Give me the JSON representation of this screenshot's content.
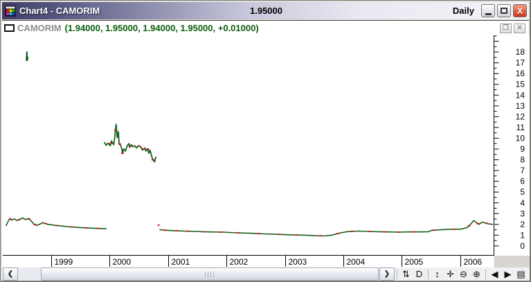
{
  "window": {
    "title": "Chart4 - CAMORIM",
    "price_display": "1.95000",
    "periodicity": "Daily",
    "close_glyph": "X"
  },
  "chart_window": {
    "symbol": "CAMORIM",
    "quote": "(1.94000, 1.95000, 1.94000, 1.95000, +0.01000)"
  },
  "chart_data": {
    "type": "line",
    "title": "CAMORIM daily price history",
    "xlim": [
      1998.23,
      2006.57
    ],
    "ylim": [
      -0.84,
      19.55
    ],
    "x_tick_years": [
      1999,
      2000,
      2001,
      2002,
      2003,
      2004,
      2005,
      2006
    ],
    "x_tick_labels": [
      "1999",
      "2000",
      "2001",
      "2002",
      "2003",
      "2004",
      "2005",
      "2006"
    ],
    "y_tick_labels": [
      0,
      1,
      2,
      3,
      4,
      5,
      6,
      7,
      8,
      9,
      10,
      11,
      12,
      13,
      14,
      15,
      16,
      17,
      18
    ],
    "y_minor_step": 0.5,
    "grid": false,
    "line_color": "#14601c",
    "down_color": "#c82020",
    "axis_color": "#000000",
    "segments": [
      {
        "name": "isolated-spike-1998",
        "width": 2,
        "points": [
          [
            1998.575,
            17.25
          ],
          [
            1998.585,
            18.0
          ],
          [
            1998.585,
            17.2
          ],
          [
            1998.6,
            17.5
          ]
        ]
      },
      {
        "name": "low-band-1998-1999",
        "width": 1.6,
        "points": [
          [
            1998.23,
            1.9
          ],
          [
            1998.25,
            2.15
          ],
          [
            1998.29,
            2.55
          ],
          [
            1998.32,
            2.4
          ],
          [
            1998.37,
            2.5
          ],
          [
            1998.42,
            2.35
          ],
          [
            1998.47,
            2.5
          ],
          [
            1998.51,
            2.6
          ],
          [
            1998.56,
            2.45
          ],
          [
            1998.61,
            2.55
          ],
          [
            1998.66,
            2.3
          ],
          [
            1998.7,
            2.05
          ],
          [
            1998.75,
            1.9
          ],
          [
            1998.8,
            2.0
          ],
          [
            1998.85,
            2.15
          ],
          [
            1998.89,
            2.1
          ],
          [
            1998.94,
            2.0
          ],
          [
            1999.01,
            1.95
          ],
          [
            1999.08,
            1.9
          ],
          [
            1999.18,
            1.85
          ],
          [
            1999.27,
            1.8
          ],
          [
            1999.37,
            1.75
          ],
          [
            1999.46,
            1.72
          ],
          [
            1999.58,
            1.68
          ],
          [
            1999.7,
            1.65
          ],
          [
            1999.82,
            1.62
          ],
          [
            1999.94,
            1.6
          ]
        ]
      },
      {
        "name": "high-band-2000",
        "width": 1.8,
        "points": [
          [
            1999.91,
            9.6
          ],
          [
            1999.94,
            9.35
          ],
          [
            1999.97,
            9.55
          ],
          [
            2000.01,
            9.3
          ],
          [
            2000.03,
            9.75
          ],
          [
            2000.07,
            9.4
          ],
          [
            2000.09,
            10.2
          ],
          [
            2000.11,
            11.3
          ],
          [
            2000.13,
            10.05
          ],
          [
            2000.15,
            10.6
          ],
          [
            2000.16,
            9.55
          ],
          [
            2000.19,
            9.3
          ],
          [
            2000.21,
            9.0
          ],
          [
            2000.22,
            8.6
          ],
          [
            2000.24,
            9.0
          ],
          [
            2000.27,
            8.8
          ],
          [
            2000.3,
            9.3
          ],
          [
            2000.33,
            9.5
          ],
          [
            2000.34,
            9.15
          ],
          [
            2000.37,
            9.4
          ],
          [
            2000.4,
            9.2
          ],
          [
            2000.43,
            9.3
          ],
          [
            2000.46,
            9.1
          ],
          [
            2000.49,
            9.3
          ],
          [
            2000.53,
            9.2
          ],
          [
            2000.56,
            8.9
          ],
          [
            2000.6,
            9.1
          ],
          [
            2000.62,
            8.8
          ],
          [
            2000.65,
            9.0
          ],
          [
            2000.67,
            8.6
          ],
          [
            2000.69,
            8.9
          ],
          [
            2000.72,
            8.3
          ],
          [
            2000.74,
            8.0
          ],
          [
            2000.77,
            7.8
          ],
          [
            2000.79,
            8.25
          ]
        ]
      },
      {
        "name": "isolated-dot-2000",
        "width": 2,
        "color": "#c82020",
        "points": [
          [
            2000.83,
            1.9
          ],
          [
            2000.845,
            1.95
          ]
        ]
      },
      {
        "name": "low-band-2000-2006",
        "width": 1.6,
        "points": [
          [
            2000.86,
            1.5
          ],
          [
            2000.98,
            1.45
          ],
          [
            2001.1,
            1.42
          ],
          [
            2001.27,
            1.38
          ],
          [
            2001.45,
            1.35
          ],
          [
            2001.69,
            1.3
          ],
          [
            2001.93,
            1.28
          ],
          [
            2002.16,
            1.22
          ],
          [
            2002.4,
            1.18
          ],
          [
            2002.64,
            1.12
          ],
          [
            2002.87,
            1.08
          ],
          [
            2003.11,
            1.03
          ],
          [
            2003.35,
            1.0
          ],
          [
            2003.53,
            0.95
          ],
          [
            2003.68,
            0.93
          ],
          [
            2003.8,
            1.0
          ],
          [
            2003.94,
            1.2
          ],
          [
            2004.06,
            1.32
          ],
          [
            2004.24,
            1.38
          ],
          [
            2004.42,
            1.35
          ],
          [
            2004.59,
            1.32
          ],
          [
            2004.77,
            1.3
          ],
          [
            2004.95,
            1.28
          ],
          [
            2005.13,
            1.3
          ],
          [
            2005.3,
            1.3
          ],
          [
            2005.46,
            1.32
          ],
          [
            2005.51,
            1.45
          ],
          [
            2005.66,
            1.5
          ],
          [
            2005.84,
            1.55
          ],
          [
            2005.98,
            1.55
          ],
          [
            2006.05,
            1.6
          ],
          [
            2006.13,
            1.75
          ],
          [
            2006.19,
            2.1
          ],
          [
            2006.23,
            2.35
          ],
          [
            2006.28,
            2.15
          ],
          [
            2006.32,
            2.0
          ],
          [
            2006.37,
            2.2
          ],
          [
            2006.42,
            2.15
          ],
          [
            2006.48,
            2.05
          ],
          [
            2006.55,
            2.0
          ]
        ]
      }
    ],
    "red_marks": [
      1998.3,
      1998.45,
      1998.62,
      1998.72,
      1998.9,
      1999.1,
      1999.35,
      1999.6,
      1999.8,
      2000.02,
      2000.1,
      2000.17,
      2000.22,
      2000.35,
      2000.5,
      2000.58,
      2000.65,
      2000.74,
      2000.95,
      2001.15,
      2001.35,
      2001.6,
      2001.9,
      2002.2,
      2002.55,
      2002.9,
      2003.2,
      2003.6,
      2003.9,
      2004.15,
      2004.45,
      2004.7,
      2004.95,
      2005.2,
      2005.55,
      2005.9,
      2006.15,
      2006.3,
      2006.45
    ]
  },
  "toolbar": {
    "groups": [
      [
        {
          "name": "rescale-icon",
          "glyph": "⇅"
        },
        {
          "name": "periodicity-daily-icon",
          "glyph": "D"
        }
      ],
      [
        {
          "name": "expand-vertical-icon",
          "glyph": "↕"
        },
        {
          "name": "pan-icon",
          "glyph": "✛"
        },
        {
          "name": "zoom-out-icon",
          "glyph": "⊖"
        },
        {
          "name": "zoom-in-icon",
          "glyph": "⊕"
        }
      ],
      [
        {
          "name": "step-left-icon",
          "glyph": "◀"
        },
        {
          "name": "step-right-icon",
          "glyph": "▶"
        },
        {
          "name": "layout-menu-icon",
          "glyph": "▤"
        }
      ]
    ]
  },
  "scrollbar": {
    "left_glyph": "❮",
    "right_glyph": "❯"
  }
}
